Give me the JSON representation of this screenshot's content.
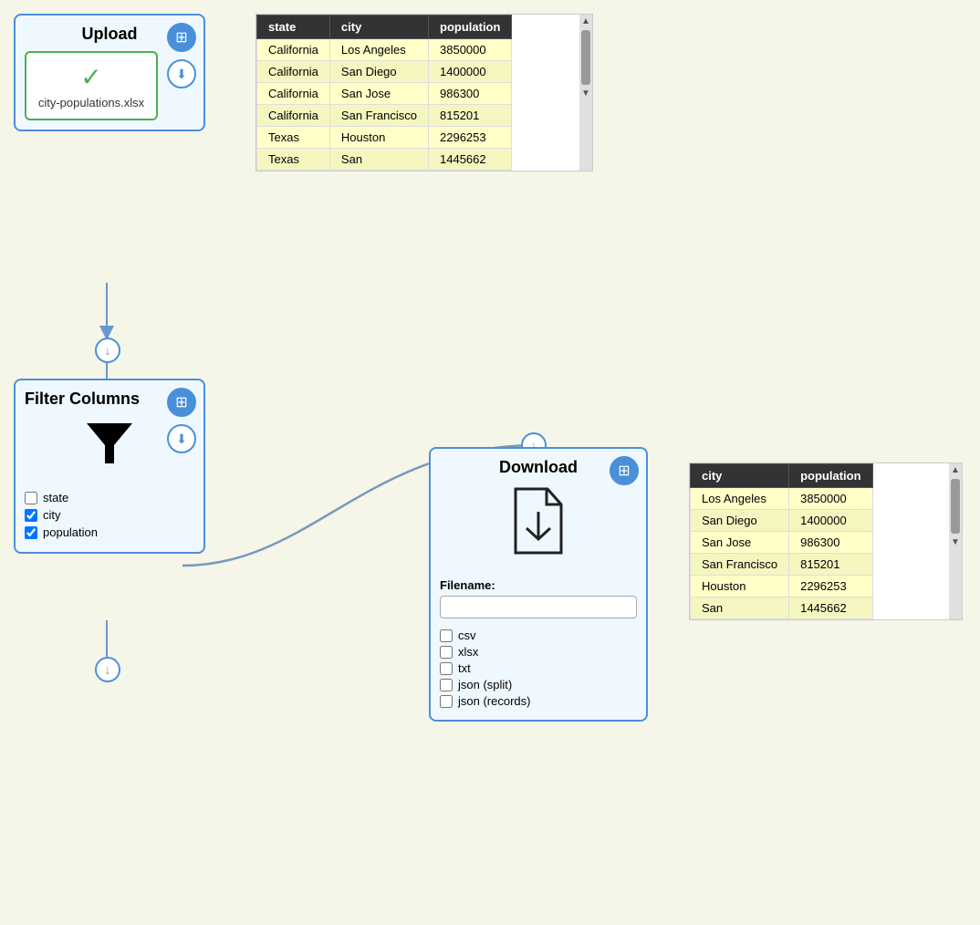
{
  "upload_node": {
    "title": "Upload",
    "file_name": "city-populations.xlsx",
    "icons": {
      "grid": "⊞",
      "download": "⬇"
    }
  },
  "filter_node": {
    "title": "Filter Columns",
    "checkboxes": [
      {
        "label": "state",
        "checked": false
      },
      {
        "label": "city",
        "checked": true
      },
      {
        "label": "population",
        "checked": true
      }
    ]
  },
  "download_node": {
    "title": "Download",
    "filename_label": "Filename:",
    "filename_value": "",
    "formats": [
      {
        "label": "csv",
        "checked": false
      },
      {
        "label": "xlsx",
        "checked": false
      },
      {
        "label": "txt",
        "checked": false
      },
      {
        "label": "json (split)",
        "checked": false
      },
      {
        "label": "json (records)",
        "checked": false
      }
    ]
  },
  "table_upload": {
    "headers": [
      "state",
      "city",
      "population"
    ],
    "rows": [
      [
        "California",
        "Los Angeles",
        "3850000"
      ],
      [
        "California",
        "San Diego",
        "1400000"
      ],
      [
        "California",
        "San Jose",
        "986300"
      ],
      [
        "California",
        "San Francisco",
        "815201"
      ],
      [
        "Texas",
        "Houston",
        "2296253"
      ],
      [
        "Texas",
        "San",
        "1445662"
      ]
    ]
  },
  "table_download": {
    "headers": [
      "city",
      "population"
    ],
    "rows": [
      [
        "Los Angeles",
        "3850000"
      ],
      [
        "San Diego",
        "1400000"
      ],
      [
        "San Jose",
        "986300"
      ],
      [
        "San Francisco",
        "815201"
      ],
      [
        "Houston",
        "2296253"
      ],
      [
        "San",
        "1445662"
      ]
    ]
  }
}
